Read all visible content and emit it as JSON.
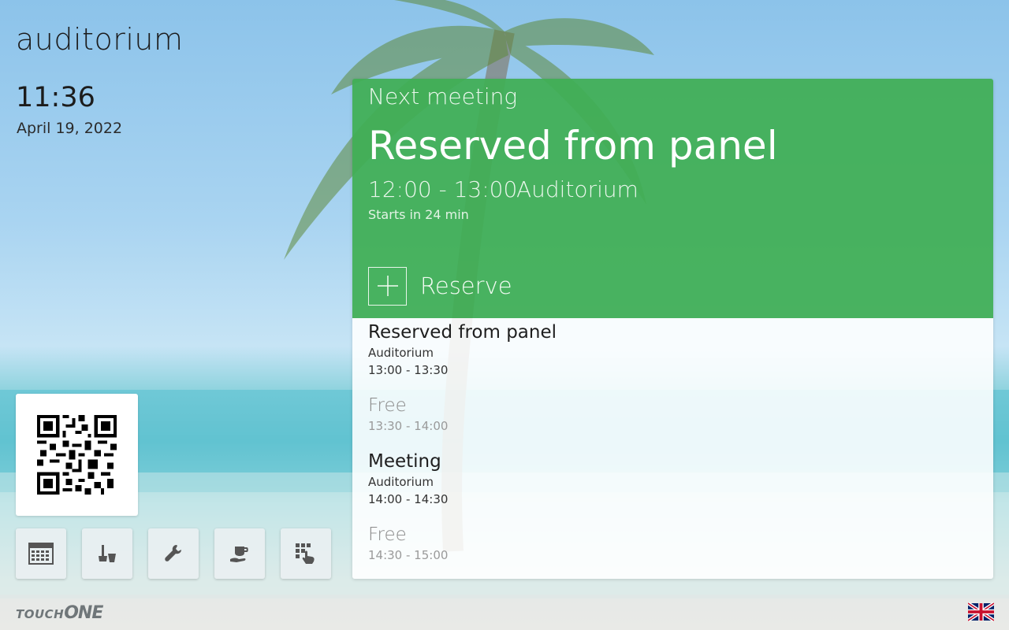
{
  "room_name": "auditorium",
  "clock": "11:36",
  "date": "April 19, 2022",
  "toolbar": {
    "buttons": [
      {
        "icon": "calendar-icon"
      },
      {
        "icon": "cleaning-icon"
      },
      {
        "icon": "wrench-icon"
      },
      {
        "icon": "catering-icon"
      },
      {
        "icon": "touch-grid-icon"
      }
    ]
  },
  "brand": {
    "part1": "TOUCH",
    "part2": "ONE"
  },
  "next_meeting": {
    "label": "Next meeting",
    "title": "Reserved from panel",
    "time": "12:00 - 13:00",
    "room": "Auditorium",
    "starts_in": "Starts in 24 min",
    "reserve_label": "Reserve"
  },
  "schedule": [
    {
      "title": "Reserved from panel",
      "room": "Auditorium",
      "time": "13:00 - 13:30",
      "free": false
    },
    {
      "title": "Free",
      "room": "",
      "time": "13:30 - 14:00",
      "free": true
    },
    {
      "title": "Meeting",
      "room": "Auditorium",
      "time": "14:00 - 14:30",
      "free": false
    },
    {
      "title": "Free",
      "room": "",
      "time": "14:30 - 15:00",
      "free": true
    }
  ],
  "colors": {
    "accent_green": "#40ae54",
    "text_dark": "#1c1c1c"
  },
  "language_flag": "uk-flag-icon"
}
